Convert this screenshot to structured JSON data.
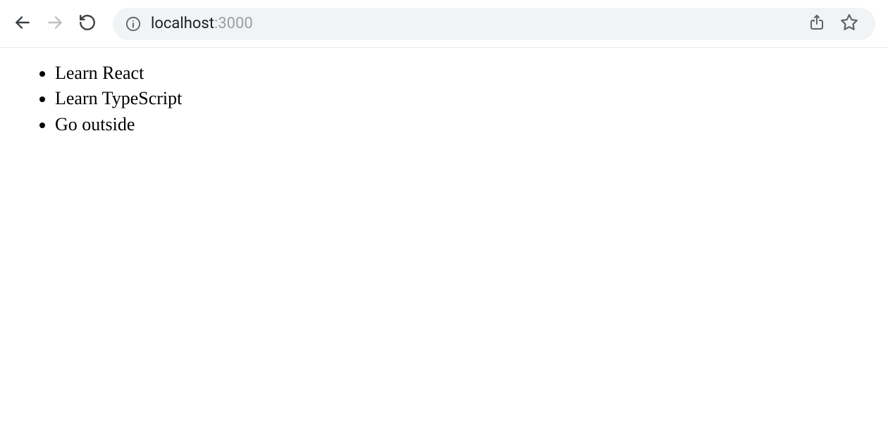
{
  "browser": {
    "url_host": "localhost",
    "url_port": ":3000"
  },
  "page": {
    "items": [
      "Learn React",
      "Learn TypeScript",
      "Go outside"
    ]
  }
}
